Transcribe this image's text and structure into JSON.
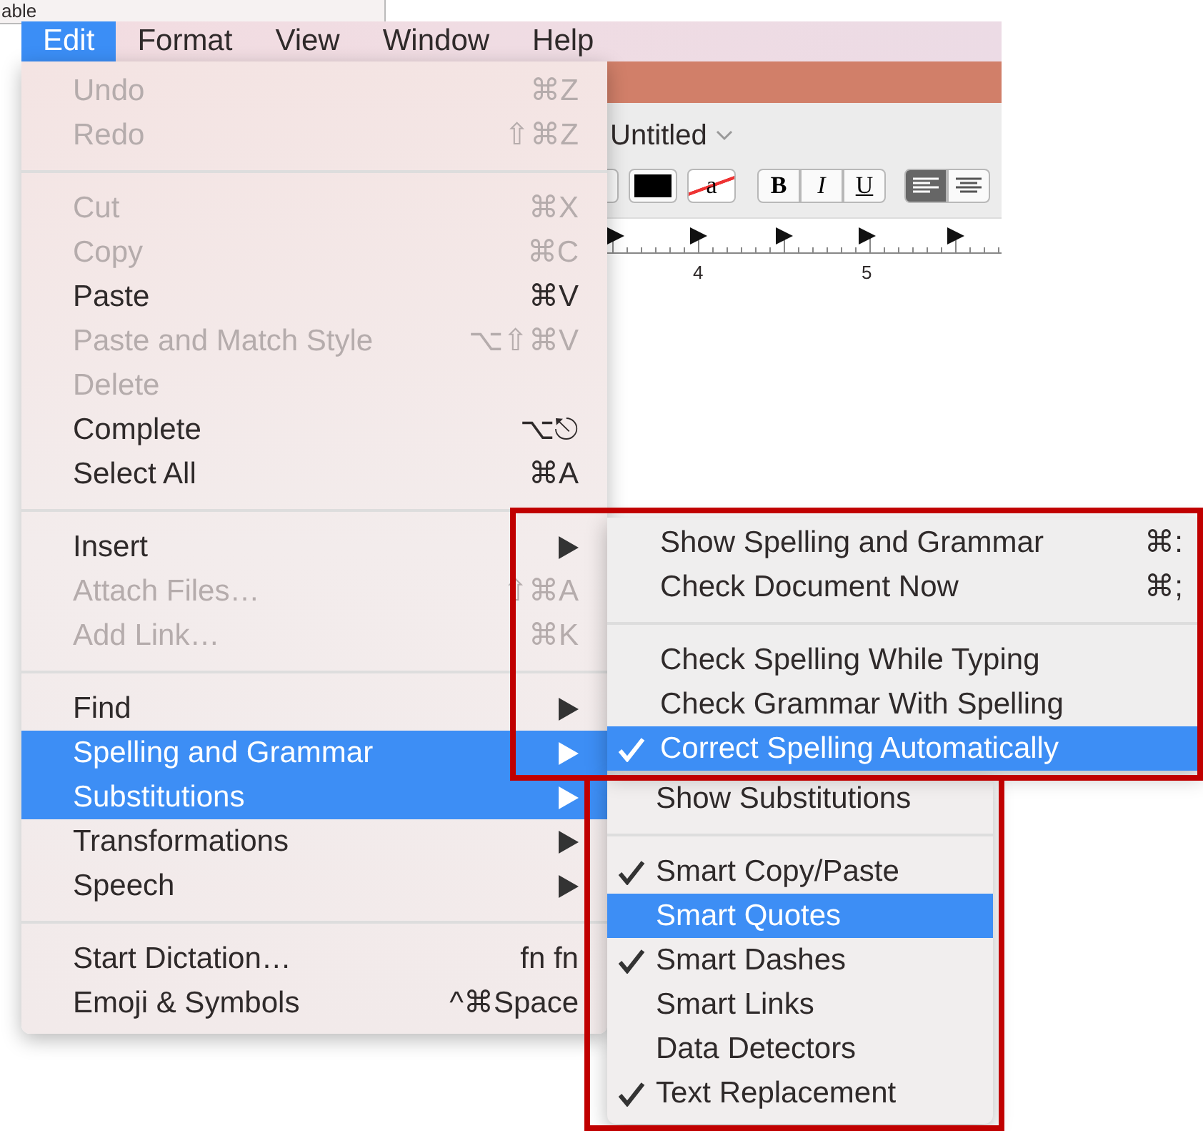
{
  "background_window": {
    "partial_text": "able"
  },
  "document_window": {
    "title": "Untitled",
    "text_color_label": "a",
    "format_buttons": [
      "B",
      "I",
      "U"
    ],
    "ruler_labels": [
      "4",
      "5"
    ]
  },
  "menu_bar": [
    {
      "label": "Edit",
      "selected": true
    },
    {
      "label": "Format",
      "selected": false
    },
    {
      "label": "View",
      "selected": false
    },
    {
      "label": "Window",
      "selected": false
    },
    {
      "label": "Help",
      "selected": false
    }
  ],
  "edit_menu": [
    {
      "kind": "item",
      "label": "Undo",
      "shortcut": "⌘Z",
      "disabled": true,
      "selected": false
    },
    {
      "kind": "item",
      "label": "Redo",
      "shortcut": "⇧⌘Z",
      "disabled": true,
      "selected": false
    },
    {
      "kind": "separator"
    },
    {
      "kind": "item",
      "label": "Cut",
      "shortcut": "⌘X",
      "disabled": true,
      "selected": false
    },
    {
      "kind": "item",
      "label": "Copy",
      "shortcut": "⌘C",
      "disabled": true,
      "selected": false
    },
    {
      "kind": "item",
      "label": "Paste",
      "shortcut": "⌘V",
      "disabled": false,
      "selected": false
    },
    {
      "kind": "item",
      "label": "Paste and Match Style",
      "shortcut": "⌥⇧⌘V",
      "disabled": true,
      "selected": false
    },
    {
      "kind": "item",
      "label": "Delete",
      "disabled": true,
      "selected": false
    },
    {
      "kind": "item",
      "label": "Complete",
      "shortcut": "⌥⎋",
      "disabled": false,
      "selected": false
    },
    {
      "kind": "item",
      "label": "Select All",
      "shortcut": "⌘A",
      "disabled": false,
      "selected": false
    },
    {
      "kind": "separator"
    },
    {
      "kind": "submenu",
      "label": "Insert",
      "disabled": false,
      "selected": false
    },
    {
      "kind": "item",
      "label": "Attach Files…",
      "shortcut": "⇧⌘A",
      "disabled": true,
      "selected": false
    },
    {
      "kind": "item",
      "label": "Add Link…",
      "shortcut": "⌘K",
      "disabled": true,
      "selected": false
    },
    {
      "kind": "separator"
    },
    {
      "kind": "submenu",
      "label": "Find",
      "disabled": false,
      "selected": false
    },
    {
      "kind": "submenu",
      "label": "Spelling and Grammar",
      "disabled": false,
      "selected": true
    },
    {
      "kind": "submenu",
      "label": "Substitutions",
      "disabled": false,
      "selected": true
    },
    {
      "kind": "submenu",
      "label": "Transformations",
      "disabled": false,
      "selected": false
    },
    {
      "kind": "submenu",
      "label": "Speech",
      "disabled": false,
      "selected": false
    },
    {
      "kind": "separator"
    },
    {
      "kind": "item",
      "label": "Start Dictation…",
      "shortcut": "fn fn",
      "disabled": false,
      "selected": false
    },
    {
      "kind": "item",
      "label": "Emoji & Symbols",
      "shortcut": "^⌘Space",
      "disabled": false,
      "selected": false
    }
  ],
  "spelling_submenu": [
    {
      "kind": "item",
      "label": "Show Spelling and Grammar",
      "shortcut": "⌘:",
      "checked": false,
      "selected": false
    },
    {
      "kind": "item",
      "label": "Check Document Now",
      "shortcut": "⌘;",
      "checked": false,
      "selected": false
    },
    {
      "kind": "separator"
    },
    {
      "kind": "item",
      "label": "Check Spelling While Typing",
      "checked": false,
      "selected": false
    },
    {
      "kind": "item",
      "label": "Check Grammar With Spelling",
      "checked": false,
      "selected": false
    },
    {
      "kind": "item",
      "label": "Correct Spelling Automatically",
      "checked": true,
      "selected": true
    }
  ],
  "substitutions_submenu": [
    {
      "kind": "item",
      "label": "Show Substitutions",
      "checked": false,
      "selected": false
    },
    {
      "kind": "separator"
    },
    {
      "kind": "item",
      "label": "Smart Copy/Paste",
      "checked": true,
      "selected": false
    },
    {
      "kind": "item",
      "label": "Smart Quotes",
      "checked": false,
      "selected": true
    },
    {
      "kind": "item",
      "label": "Smart Dashes",
      "checked": true,
      "selected": false
    },
    {
      "kind": "item",
      "label": "Smart Links",
      "checked": false,
      "selected": false
    },
    {
      "kind": "item",
      "label": "Data Detectors",
      "checked": false,
      "selected": false
    },
    {
      "kind": "item",
      "label": "Text Replacement",
      "checked": true,
      "selected": false
    }
  ]
}
